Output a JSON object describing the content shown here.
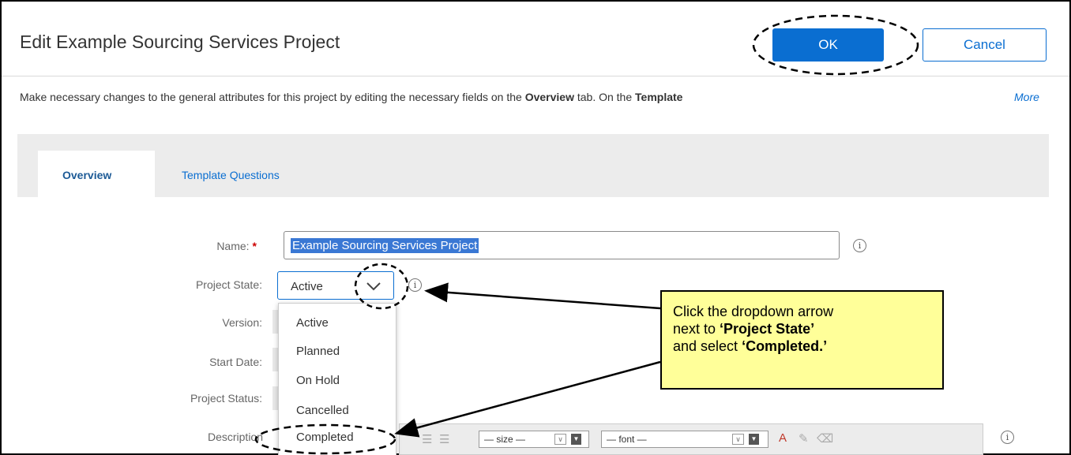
{
  "dialog": {
    "title": "Edit Example Sourcing Services Project",
    "ok_label": "OK",
    "cancel_label": "Cancel"
  },
  "description": {
    "part1": "Make necessary changes to the general attributes for this project by editing the necessary fields on the ",
    "bold1": "Overview",
    "part2": " tab. On the ",
    "bold2": "Template",
    "more": "More"
  },
  "tabs": [
    {
      "label": "Overview",
      "active": true
    },
    {
      "label": "Template Questions",
      "active": false
    }
  ],
  "form": {
    "name_label": "Name:",
    "required_marker": "*",
    "name_value": "Example Sourcing Services Project",
    "project_state_label": "Project State:",
    "project_state_value": "Active",
    "version_label": "Version:",
    "start_date_label": "Start Date:",
    "project_status_label": "Project Status:",
    "description_label": "Description"
  },
  "project_state_options": [
    "Active",
    "Planned",
    "On Hold",
    "Cancelled",
    "Completed"
  ],
  "editor_toolbar": {
    "size_placeholder": "— size —",
    "font_placeholder": "— font —"
  },
  "callout": {
    "line1": "Click the dropdown arrow",
    "line2_plain": "next to ",
    "line2_bold": "‘Project State’",
    "line3_plain": "and select ",
    "line3_bold": "‘Completed.’"
  },
  "colors": {
    "primary": "#0a6ed1",
    "callout_bg": "#ffff99",
    "selection": "#3a78d4",
    "required": "#cc0000"
  },
  "icons": {
    "info": "info-circle-icon",
    "dropdown": "chevron-down-icon"
  }
}
